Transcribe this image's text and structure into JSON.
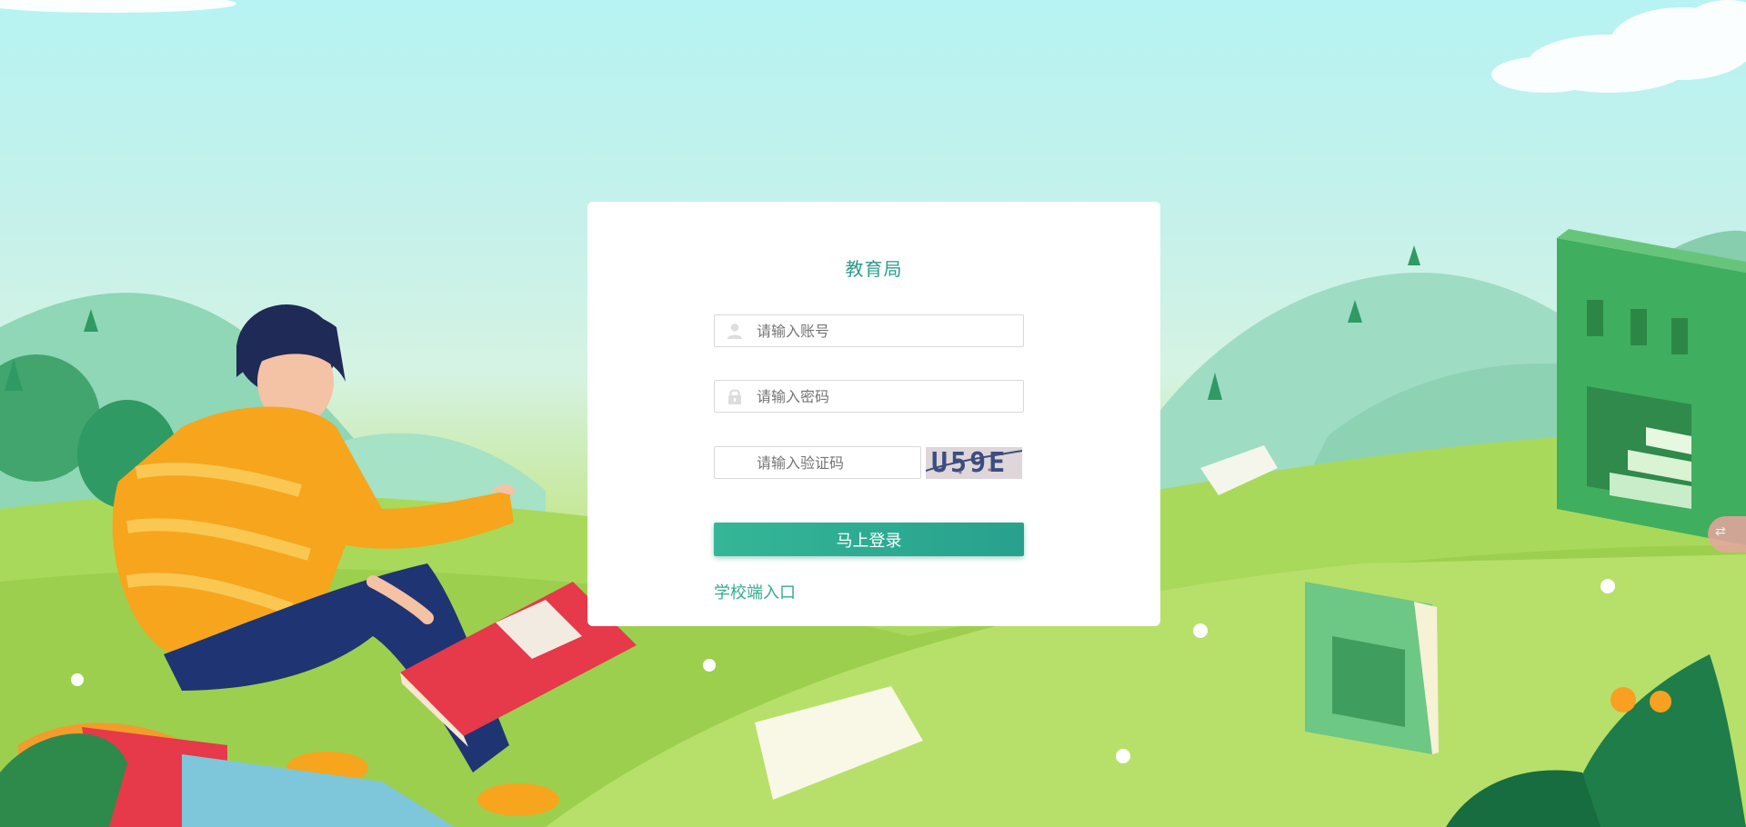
{
  "login": {
    "title": "教育局",
    "account_placeholder": "请输入账号",
    "password_placeholder": "请输入密码",
    "captcha_placeholder": "请输入验证码",
    "captcha_text": "U59E",
    "submit_label": "马上登录",
    "school_entry_link": "学校端入口"
  },
  "colors": {
    "accent": "#2a9b8b",
    "button_start": "#35b697",
    "button_end": "#27a18e",
    "link": "#32ab8e",
    "card": "#ffffff"
  },
  "icons": {
    "account": "user-icon",
    "password": "lock-icon",
    "translate": "translate-icon"
  }
}
